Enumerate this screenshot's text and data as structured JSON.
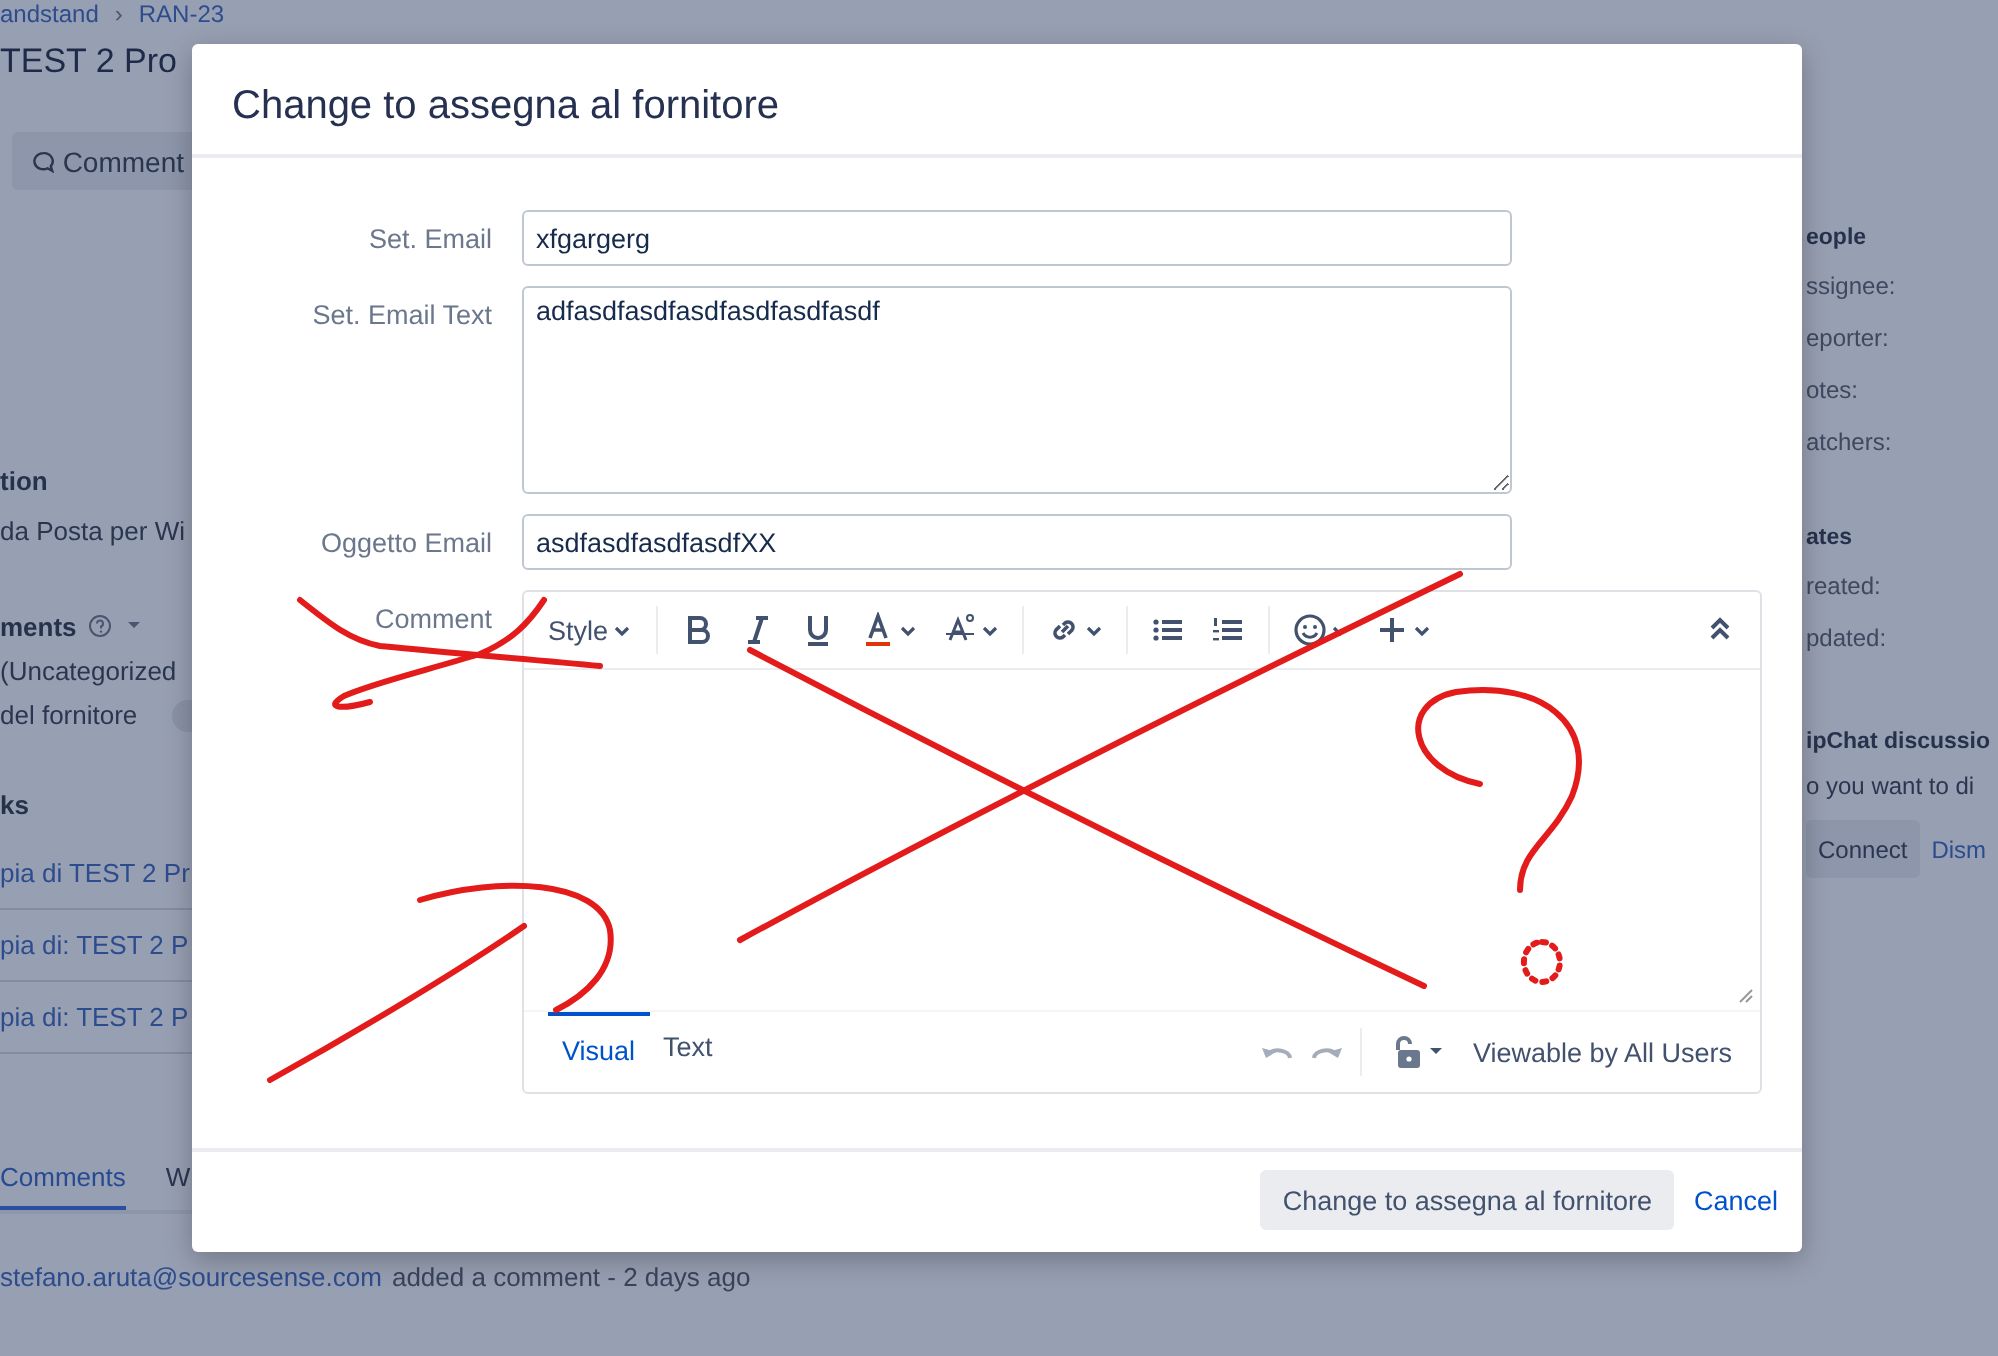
{
  "background_page": {
    "breadcrumbs": [
      "andstand",
      "›",
      "RAN-23"
    ],
    "title": "TEST 2 Pro",
    "comment_button": "Comment",
    "left_sections": [
      {
        "kind": "heading",
        "text": "tion"
      },
      {
        "kind": "line",
        "text": "da Posta per Wi"
      },
      {
        "kind": "heading_help",
        "text": "ments"
      },
      {
        "kind": "line",
        "text": "(Uncategorized"
      },
      {
        "kind": "line_lozenge",
        "text": "del fornitore"
      },
      {
        "kind": "heading",
        "text": "ks"
      },
      {
        "kind": "link",
        "text": "pia di TEST 2 Pr"
      },
      {
        "kind": "link",
        "text": "pia di: TEST 2 P"
      },
      {
        "kind": "link",
        "text": "pia di: TEST 2 P"
      }
    ],
    "activity_tabs": [
      {
        "label": "Comments",
        "selected": true
      },
      {
        "label": "W",
        "selected": false
      }
    ],
    "comment_author": "stefano.aruta@sourcesense.com",
    "comment_action": "added a comment - 2 days ago",
    "right_sections": [
      {
        "kind": "heading",
        "text": "eople"
      },
      {
        "kind": "label",
        "text": "ssignee:"
      },
      {
        "kind": "label",
        "text": "eporter:"
      },
      {
        "kind": "label",
        "text": "otes:"
      },
      {
        "kind": "label",
        "text": "atchers:"
      },
      {
        "kind": "heading",
        "text": "ates"
      },
      {
        "kind": "label",
        "text": "reated:"
      },
      {
        "kind": "label",
        "text": "pdated:"
      },
      {
        "kind": "heading",
        "text": "ipChat discussio"
      },
      {
        "kind": "line",
        "text": "o you want to di"
      }
    ],
    "connect_button": "Connect",
    "dismiss_link": "Dism"
  },
  "dialog": {
    "title": "Change to assegna al fornitore",
    "fields": [
      {
        "kind": "input",
        "label": "Set. Email",
        "value": "xfgargerg"
      },
      {
        "kind": "textarea",
        "label": "Set. Email Text",
        "value": "adfasdfasdfasdfasdfasdfasdf"
      },
      {
        "kind": "input",
        "label": "Oggetto Email",
        "value": "asdfasdfasdfasdfXX"
      }
    ],
    "comment": {
      "label": "Comment",
      "style_menu": "Style",
      "editor_tabs": [
        {
          "label": "Visual",
          "selected": true
        },
        {
          "label": "Text",
          "selected": false
        }
      ],
      "visibility": "Viewable by All Users"
    },
    "submit_button": "Change to assegna al fornitore",
    "cancel_link": "Cancel"
  }
}
